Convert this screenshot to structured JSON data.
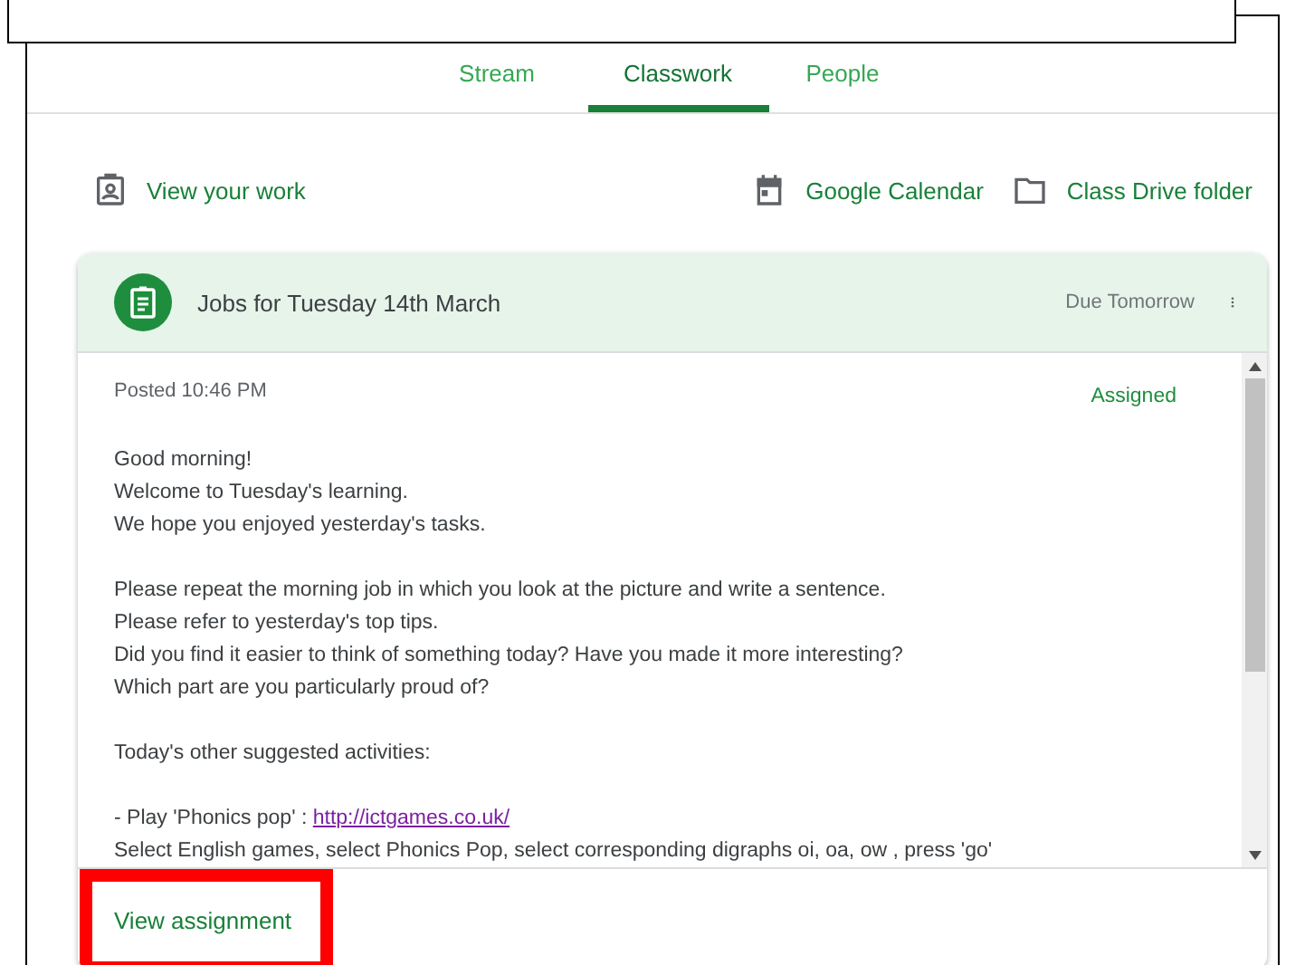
{
  "tabs": [
    {
      "label": "Stream",
      "selected": false
    },
    {
      "label": "Classwork",
      "selected": true
    },
    {
      "label": "People",
      "selected": false
    }
  ],
  "toolbar": {
    "view_work": "View your work",
    "calendar": "Google Calendar",
    "drive": "Class Drive folder"
  },
  "assignment": {
    "title": "Jobs for Tuesday 14th March",
    "due": "Due Tomorrow",
    "posted": "Posted 10:46 PM",
    "status": "Assigned",
    "body": [
      {
        "kind": "text",
        "text": "Good morning!"
      },
      {
        "kind": "text",
        "text": "Welcome to Tuesday's learning."
      },
      {
        "kind": "text",
        "text": "We hope you enjoyed yesterday's tasks."
      },
      {
        "kind": "blank"
      },
      {
        "kind": "text",
        "text": "Please repeat the morning job in which you look at the picture and write a sentence."
      },
      {
        "kind": "text",
        "text": "Please refer to yesterday's top tips."
      },
      {
        "kind": "text",
        "text": "Did you find it easier to think of something today? Have you made it more interesting?"
      },
      {
        "kind": "text",
        "text": "Which part are you particularly proud of?"
      },
      {
        "kind": "blank"
      },
      {
        "kind": "text",
        "text": "Today's other suggested activities:"
      },
      {
        "kind": "blank"
      },
      {
        "kind": "link",
        "text": "- Play 'Phonics pop' : ",
        "link": "http://ictgames.co.uk/"
      },
      {
        "kind": "text",
        "text": "Select English games, select Phonics Pop, select corresponding digraphs oi, oa, ow , press 'go'"
      }
    ],
    "action": "View assignment"
  }
}
